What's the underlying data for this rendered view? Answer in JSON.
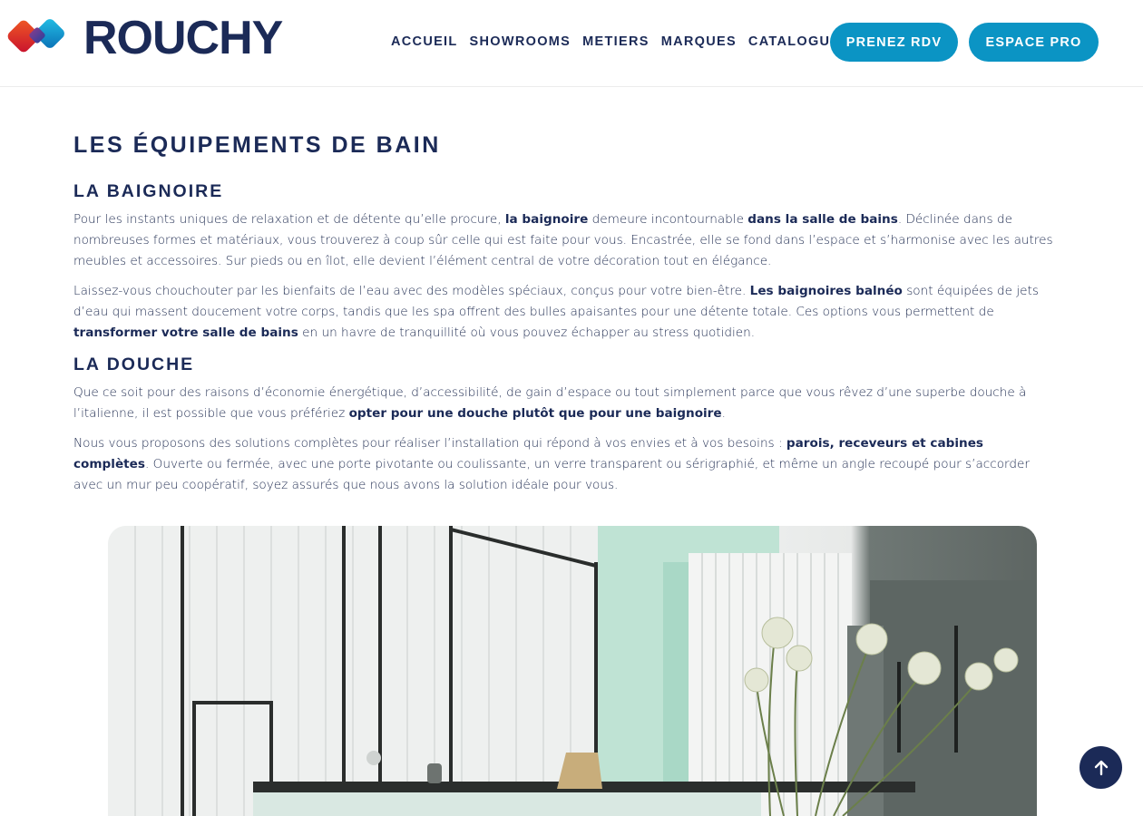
{
  "brand": {
    "name": "ROUCHY"
  },
  "nav": {
    "items": [
      "ACCUEIL",
      "SHOWROOMS",
      "METIERS",
      "MARQUES",
      "CATALOGUES"
    ],
    "cta_rdv": "PRENEZ RDV",
    "cta_pro": "ESPACE PRO"
  },
  "colors": {
    "accent": "#0b94c4",
    "navy": "#1b2a57"
  },
  "page": {
    "title": "LES ÉQUIPEMENTS DE BAIN",
    "baignoire": {
      "heading": "LA BAIGNOIRE",
      "p1": [
        "Pour les instants uniques de relaxation et de détente qu’elle procure, ",
        "la baignoire",
        " demeure incontournable ",
        "dans la salle de bains",
        ". Déclinée dans de nombreuses formes et matériaux, vous trouverez à coup sûr celle qui est faite pour vous. Encastrée, elle se fond dans l’espace et s’harmonise avec les autres meubles et accessoires. Sur pieds ou en îlot, elle devient l’élément central de votre décoration tout en élégance."
      ],
      "p2": [
        "Laissez-vous chouchouter par les bienfaits de l’eau avec des modèles spéciaux, conçus pour votre bien-être. ",
        "Les baignoires balnéo",
        " sont équipées de jets d’eau qui massent doucement votre corps, tandis que les spa offrent des bulles apaisantes pour une détente totale. Ces options vous permettent de ",
        "transformer votre salle de bains",
        " en un havre de tranquillité où vous pouvez échapper au stress quotidien."
      ]
    },
    "douche": {
      "heading": "LA DOUCHE",
      "p1": [
        "Que ce soit pour des raisons d’économie énergétique, d’accessibilité, de gain d’espace ou tout simplement parce que vous rêvez d’une superbe douche à l’italienne, il est possible que vous préfériez ",
        "opter pour une douche plutôt que pour une baignoire",
        "."
      ],
      "p2": [
        "Nous vous proposons des solutions complètes pour réaliser l’installation qui répond à vos envies et à vos besoins : ",
        "parois, receveurs et cabines complètes",
        ". Ouverte ou fermée, avec une porte pivotante ou coulissante, un verre transparent ou sérigraphié, et même un angle recoupé pour s’accorder avec un mur peu coopératif, soyez assurés que nous avons la solution idéale pour vous."
      ]
    }
  }
}
